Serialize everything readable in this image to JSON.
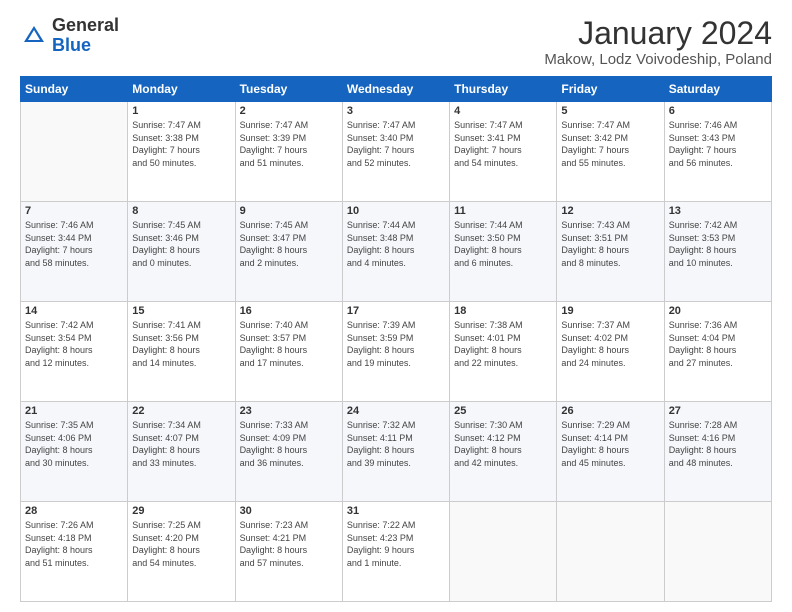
{
  "logo": {
    "general": "General",
    "blue": "Blue"
  },
  "title": {
    "month": "January 2024",
    "location": "Makow, Lodz Voivodeship, Poland"
  },
  "weekdays": [
    "Sunday",
    "Monday",
    "Tuesday",
    "Wednesday",
    "Thursday",
    "Friday",
    "Saturday"
  ],
  "weeks": [
    [
      {
        "day": "",
        "info": ""
      },
      {
        "day": "1",
        "info": "Sunrise: 7:47 AM\nSunset: 3:38 PM\nDaylight: 7 hours\nand 50 minutes."
      },
      {
        "day": "2",
        "info": "Sunrise: 7:47 AM\nSunset: 3:39 PM\nDaylight: 7 hours\nand 51 minutes."
      },
      {
        "day": "3",
        "info": "Sunrise: 7:47 AM\nSunset: 3:40 PM\nDaylight: 7 hours\nand 52 minutes."
      },
      {
        "day": "4",
        "info": "Sunrise: 7:47 AM\nSunset: 3:41 PM\nDaylight: 7 hours\nand 54 minutes."
      },
      {
        "day": "5",
        "info": "Sunrise: 7:47 AM\nSunset: 3:42 PM\nDaylight: 7 hours\nand 55 minutes."
      },
      {
        "day": "6",
        "info": "Sunrise: 7:46 AM\nSunset: 3:43 PM\nDaylight: 7 hours\nand 56 minutes."
      }
    ],
    [
      {
        "day": "7",
        "info": "Sunrise: 7:46 AM\nSunset: 3:44 PM\nDaylight: 7 hours\nand 58 minutes."
      },
      {
        "day": "8",
        "info": "Sunrise: 7:45 AM\nSunset: 3:46 PM\nDaylight: 8 hours\nand 0 minutes."
      },
      {
        "day": "9",
        "info": "Sunrise: 7:45 AM\nSunset: 3:47 PM\nDaylight: 8 hours\nand 2 minutes."
      },
      {
        "day": "10",
        "info": "Sunrise: 7:44 AM\nSunset: 3:48 PM\nDaylight: 8 hours\nand 4 minutes."
      },
      {
        "day": "11",
        "info": "Sunrise: 7:44 AM\nSunset: 3:50 PM\nDaylight: 8 hours\nand 6 minutes."
      },
      {
        "day": "12",
        "info": "Sunrise: 7:43 AM\nSunset: 3:51 PM\nDaylight: 8 hours\nand 8 minutes."
      },
      {
        "day": "13",
        "info": "Sunrise: 7:42 AM\nSunset: 3:53 PM\nDaylight: 8 hours\nand 10 minutes."
      }
    ],
    [
      {
        "day": "14",
        "info": "Sunrise: 7:42 AM\nSunset: 3:54 PM\nDaylight: 8 hours\nand 12 minutes."
      },
      {
        "day": "15",
        "info": "Sunrise: 7:41 AM\nSunset: 3:56 PM\nDaylight: 8 hours\nand 14 minutes."
      },
      {
        "day": "16",
        "info": "Sunrise: 7:40 AM\nSunset: 3:57 PM\nDaylight: 8 hours\nand 17 minutes."
      },
      {
        "day": "17",
        "info": "Sunrise: 7:39 AM\nSunset: 3:59 PM\nDaylight: 8 hours\nand 19 minutes."
      },
      {
        "day": "18",
        "info": "Sunrise: 7:38 AM\nSunset: 4:01 PM\nDaylight: 8 hours\nand 22 minutes."
      },
      {
        "day": "19",
        "info": "Sunrise: 7:37 AM\nSunset: 4:02 PM\nDaylight: 8 hours\nand 24 minutes."
      },
      {
        "day": "20",
        "info": "Sunrise: 7:36 AM\nSunset: 4:04 PM\nDaylight: 8 hours\nand 27 minutes."
      }
    ],
    [
      {
        "day": "21",
        "info": "Sunrise: 7:35 AM\nSunset: 4:06 PM\nDaylight: 8 hours\nand 30 minutes."
      },
      {
        "day": "22",
        "info": "Sunrise: 7:34 AM\nSunset: 4:07 PM\nDaylight: 8 hours\nand 33 minutes."
      },
      {
        "day": "23",
        "info": "Sunrise: 7:33 AM\nSunset: 4:09 PM\nDaylight: 8 hours\nand 36 minutes."
      },
      {
        "day": "24",
        "info": "Sunrise: 7:32 AM\nSunset: 4:11 PM\nDaylight: 8 hours\nand 39 minutes."
      },
      {
        "day": "25",
        "info": "Sunrise: 7:30 AM\nSunset: 4:12 PM\nDaylight: 8 hours\nand 42 minutes."
      },
      {
        "day": "26",
        "info": "Sunrise: 7:29 AM\nSunset: 4:14 PM\nDaylight: 8 hours\nand 45 minutes."
      },
      {
        "day": "27",
        "info": "Sunrise: 7:28 AM\nSunset: 4:16 PM\nDaylight: 8 hours\nand 48 minutes."
      }
    ],
    [
      {
        "day": "28",
        "info": "Sunrise: 7:26 AM\nSunset: 4:18 PM\nDaylight: 8 hours\nand 51 minutes."
      },
      {
        "day": "29",
        "info": "Sunrise: 7:25 AM\nSunset: 4:20 PM\nDaylight: 8 hours\nand 54 minutes."
      },
      {
        "day": "30",
        "info": "Sunrise: 7:23 AM\nSunset: 4:21 PM\nDaylight: 8 hours\nand 57 minutes."
      },
      {
        "day": "31",
        "info": "Sunrise: 7:22 AM\nSunset: 4:23 PM\nDaylight: 9 hours\nand 1 minute."
      },
      {
        "day": "",
        "info": ""
      },
      {
        "day": "",
        "info": ""
      },
      {
        "day": "",
        "info": ""
      }
    ]
  ]
}
